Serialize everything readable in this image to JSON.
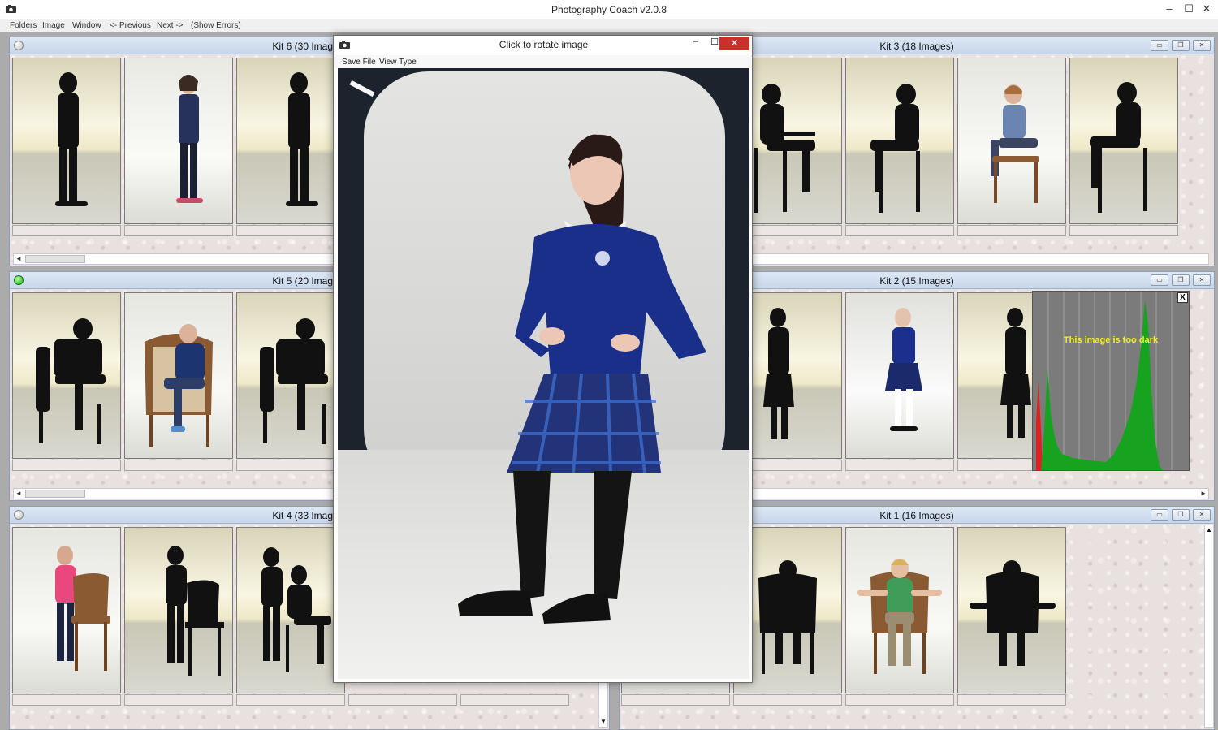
{
  "window": {
    "title": "Photography Coach  v2.0.8",
    "minimize": "–",
    "maximize": "☐",
    "close": "✕"
  },
  "menu": {
    "folders": "Folders",
    "image": "Image",
    "window": "Window",
    "previous": "<- Previous",
    "next": "Next ->",
    "show_errors": "(Show Errors)"
  },
  "kits": {
    "kit6": {
      "title": "Kit 6  (30 Images)",
      "status": "grey"
    },
    "kit3": {
      "title": "Kit 3  (18 Images)",
      "status": "grey"
    },
    "kit5": {
      "title": "Kit 5  (20 Images)",
      "status": "green"
    },
    "kit2": {
      "title": "Kit 2  (15 Images)",
      "status": "grey"
    },
    "kit4": {
      "title": "Kit 4  (33 Images)",
      "status": "grey"
    },
    "kit1": {
      "title": "Kit 1  (16 Images)",
      "status": "grey"
    }
  },
  "kit_buttons": {
    "minimize": "▭",
    "restore": "❐",
    "close": "✕"
  },
  "viewer": {
    "title": "Click to rotate image",
    "menu_save": "Save File",
    "menu_view": "View Type",
    "minimize": "–",
    "maximize": "☐",
    "close": "✕"
  },
  "histogram": {
    "message": "This image is too dark",
    "close": "X"
  },
  "scroll": {
    "left": "◄",
    "right": "►",
    "up": "▲",
    "down": "▼"
  },
  "colors": {
    "status_green": "#14b314",
    "status_grey": "#bdbdbd",
    "close_red": "#c7302b",
    "warning_yellow": "#f0ef1e",
    "histogram_green": "#17a31f",
    "histogram_red": "#e02020"
  }
}
